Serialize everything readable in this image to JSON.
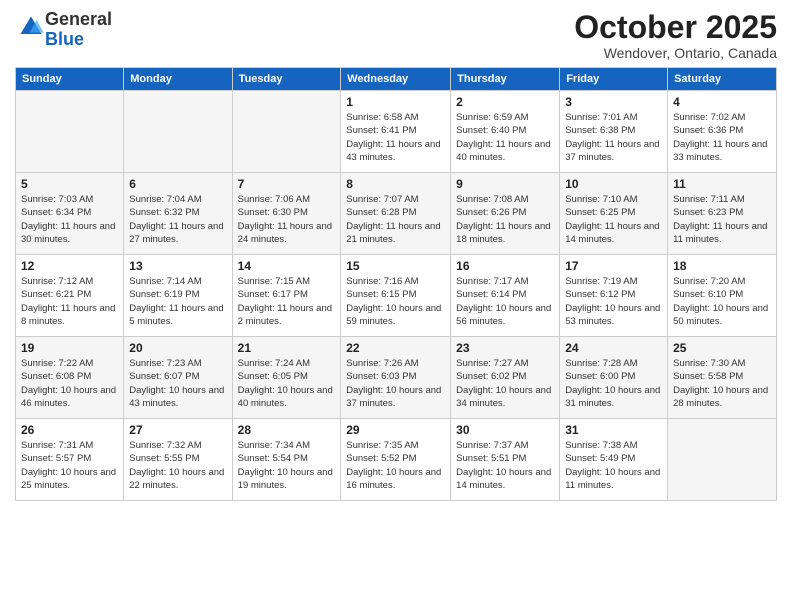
{
  "header": {
    "logo_general": "General",
    "logo_blue": "Blue",
    "month_title": "October 2025",
    "location": "Wendover, Ontario, Canada"
  },
  "weekdays": [
    "Sunday",
    "Monday",
    "Tuesday",
    "Wednesday",
    "Thursday",
    "Friday",
    "Saturday"
  ],
  "weeks": [
    [
      {
        "day": "",
        "sunrise": "",
        "sunset": "",
        "daylight": ""
      },
      {
        "day": "",
        "sunrise": "",
        "sunset": "",
        "daylight": ""
      },
      {
        "day": "",
        "sunrise": "",
        "sunset": "",
        "daylight": ""
      },
      {
        "day": "1",
        "sunrise": "Sunrise: 6:58 AM",
        "sunset": "Sunset: 6:41 PM",
        "daylight": "Daylight: 11 hours and 43 minutes."
      },
      {
        "day": "2",
        "sunrise": "Sunrise: 6:59 AM",
        "sunset": "Sunset: 6:40 PM",
        "daylight": "Daylight: 11 hours and 40 minutes."
      },
      {
        "day": "3",
        "sunrise": "Sunrise: 7:01 AM",
        "sunset": "Sunset: 6:38 PM",
        "daylight": "Daylight: 11 hours and 37 minutes."
      },
      {
        "day": "4",
        "sunrise": "Sunrise: 7:02 AM",
        "sunset": "Sunset: 6:36 PM",
        "daylight": "Daylight: 11 hours and 33 minutes."
      }
    ],
    [
      {
        "day": "5",
        "sunrise": "Sunrise: 7:03 AM",
        "sunset": "Sunset: 6:34 PM",
        "daylight": "Daylight: 11 hours and 30 minutes."
      },
      {
        "day": "6",
        "sunrise": "Sunrise: 7:04 AM",
        "sunset": "Sunset: 6:32 PM",
        "daylight": "Daylight: 11 hours and 27 minutes."
      },
      {
        "day": "7",
        "sunrise": "Sunrise: 7:06 AM",
        "sunset": "Sunset: 6:30 PM",
        "daylight": "Daylight: 11 hours and 24 minutes."
      },
      {
        "day": "8",
        "sunrise": "Sunrise: 7:07 AM",
        "sunset": "Sunset: 6:28 PM",
        "daylight": "Daylight: 11 hours and 21 minutes."
      },
      {
        "day": "9",
        "sunrise": "Sunrise: 7:08 AM",
        "sunset": "Sunset: 6:26 PM",
        "daylight": "Daylight: 11 hours and 18 minutes."
      },
      {
        "day": "10",
        "sunrise": "Sunrise: 7:10 AM",
        "sunset": "Sunset: 6:25 PM",
        "daylight": "Daylight: 11 hours and 14 minutes."
      },
      {
        "day": "11",
        "sunrise": "Sunrise: 7:11 AM",
        "sunset": "Sunset: 6:23 PM",
        "daylight": "Daylight: 11 hours and 11 minutes."
      }
    ],
    [
      {
        "day": "12",
        "sunrise": "Sunrise: 7:12 AM",
        "sunset": "Sunset: 6:21 PM",
        "daylight": "Daylight: 11 hours and 8 minutes."
      },
      {
        "day": "13",
        "sunrise": "Sunrise: 7:14 AM",
        "sunset": "Sunset: 6:19 PM",
        "daylight": "Daylight: 11 hours and 5 minutes."
      },
      {
        "day": "14",
        "sunrise": "Sunrise: 7:15 AM",
        "sunset": "Sunset: 6:17 PM",
        "daylight": "Daylight: 11 hours and 2 minutes."
      },
      {
        "day": "15",
        "sunrise": "Sunrise: 7:16 AM",
        "sunset": "Sunset: 6:15 PM",
        "daylight": "Daylight: 10 hours and 59 minutes."
      },
      {
        "day": "16",
        "sunrise": "Sunrise: 7:17 AM",
        "sunset": "Sunset: 6:14 PM",
        "daylight": "Daylight: 10 hours and 56 minutes."
      },
      {
        "day": "17",
        "sunrise": "Sunrise: 7:19 AM",
        "sunset": "Sunset: 6:12 PM",
        "daylight": "Daylight: 10 hours and 53 minutes."
      },
      {
        "day": "18",
        "sunrise": "Sunrise: 7:20 AM",
        "sunset": "Sunset: 6:10 PM",
        "daylight": "Daylight: 10 hours and 50 minutes."
      }
    ],
    [
      {
        "day": "19",
        "sunrise": "Sunrise: 7:22 AM",
        "sunset": "Sunset: 6:08 PM",
        "daylight": "Daylight: 10 hours and 46 minutes."
      },
      {
        "day": "20",
        "sunrise": "Sunrise: 7:23 AM",
        "sunset": "Sunset: 6:07 PM",
        "daylight": "Daylight: 10 hours and 43 minutes."
      },
      {
        "day": "21",
        "sunrise": "Sunrise: 7:24 AM",
        "sunset": "Sunset: 6:05 PM",
        "daylight": "Daylight: 10 hours and 40 minutes."
      },
      {
        "day": "22",
        "sunrise": "Sunrise: 7:26 AM",
        "sunset": "Sunset: 6:03 PM",
        "daylight": "Daylight: 10 hours and 37 minutes."
      },
      {
        "day": "23",
        "sunrise": "Sunrise: 7:27 AM",
        "sunset": "Sunset: 6:02 PM",
        "daylight": "Daylight: 10 hours and 34 minutes."
      },
      {
        "day": "24",
        "sunrise": "Sunrise: 7:28 AM",
        "sunset": "Sunset: 6:00 PM",
        "daylight": "Daylight: 10 hours and 31 minutes."
      },
      {
        "day": "25",
        "sunrise": "Sunrise: 7:30 AM",
        "sunset": "Sunset: 5:58 PM",
        "daylight": "Daylight: 10 hours and 28 minutes."
      }
    ],
    [
      {
        "day": "26",
        "sunrise": "Sunrise: 7:31 AM",
        "sunset": "Sunset: 5:57 PM",
        "daylight": "Daylight: 10 hours and 25 minutes."
      },
      {
        "day": "27",
        "sunrise": "Sunrise: 7:32 AM",
        "sunset": "Sunset: 5:55 PM",
        "daylight": "Daylight: 10 hours and 22 minutes."
      },
      {
        "day": "28",
        "sunrise": "Sunrise: 7:34 AM",
        "sunset": "Sunset: 5:54 PM",
        "daylight": "Daylight: 10 hours and 19 minutes."
      },
      {
        "day": "29",
        "sunrise": "Sunrise: 7:35 AM",
        "sunset": "Sunset: 5:52 PM",
        "daylight": "Daylight: 10 hours and 16 minutes."
      },
      {
        "day": "30",
        "sunrise": "Sunrise: 7:37 AM",
        "sunset": "Sunset: 5:51 PM",
        "daylight": "Daylight: 10 hours and 14 minutes."
      },
      {
        "day": "31",
        "sunrise": "Sunrise: 7:38 AM",
        "sunset": "Sunset: 5:49 PM",
        "daylight": "Daylight: 10 hours and 11 minutes."
      },
      {
        "day": "",
        "sunrise": "",
        "sunset": "",
        "daylight": ""
      }
    ]
  ]
}
